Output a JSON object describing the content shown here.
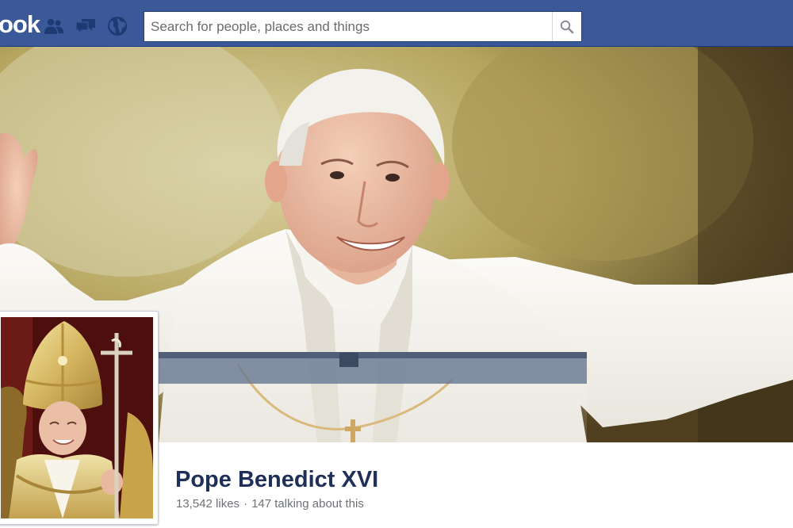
{
  "header": {
    "logo_text": "ook",
    "search": {
      "placeholder": "Search for people, places and things",
      "value": ""
    },
    "icons": [
      "friends-icon",
      "messages-icon",
      "notifications-icon",
      "search-icon"
    ]
  },
  "colors": {
    "brand_blue": "#3b5998",
    "brand_dark_blue": "#133783",
    "name_text": "#1e2f58",
    "stat_text": "#6e7175"
  },
  "profile": {
    "name": "Pope Benedict XVI",
    "likes": "13,542 likes",
    "separator": "·",
    "talking": "147 talking about this"
  }
}
